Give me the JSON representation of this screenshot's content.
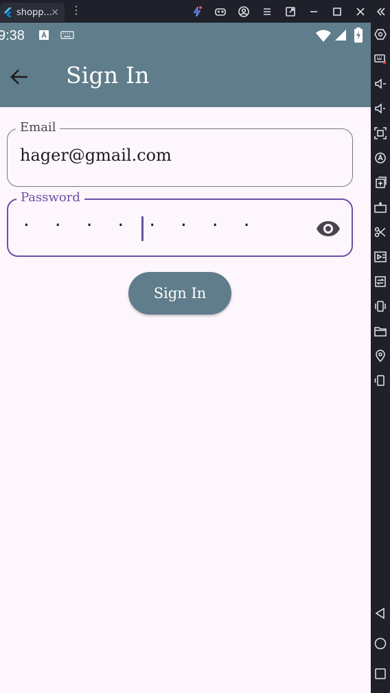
{
  "window": {
    "tab_title": "shopp...",
    "tab_close": "×",
    "menu_glyph": "⋮"
  },
  "status": {
    "time": "9:38"
  },
  "appbar": {
    "title": "Sign In"
  },
  "form": {
    "email_label": "Email",
    "email_value": "hager@gmail.com",
    "password_label": "Password",
    "password_value": "· · · · · · · ·",
    "submit_label": "Sign In"
  },
  "colors": {
    "appbar": "#607d8b",
    "background": "#fdf6fd",
    "focus": "#6750a4"
  }
}
